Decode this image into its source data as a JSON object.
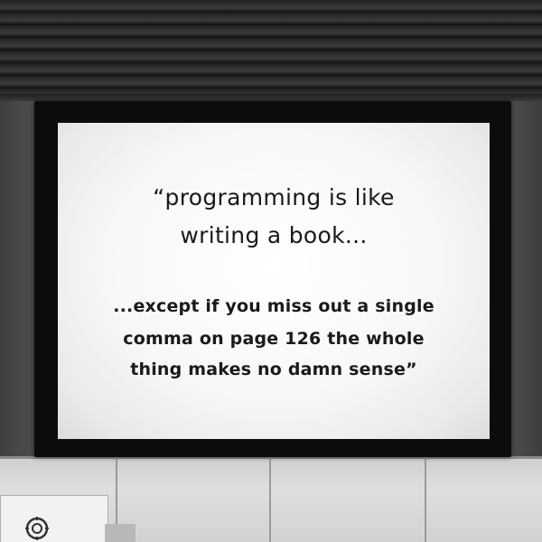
{
  "slide": {
    "quote_line_1": "“programming is like",
    "quote_line_2": "writing a book...",
    "quote_line_3": "...except if you miss out a single",
    "quote_line_4": "comma on page 126 the whole",
    "quote_line_5": "thing makes no damn sense”"
  },
  "icons": {
    "sign_icon": "circular-logo-icon"
  },
  "colors": {
    "screen": "#f7f7f7",
    "frame": "#0c0c0c",
    "text": "#1a1a1a"
  }
}
